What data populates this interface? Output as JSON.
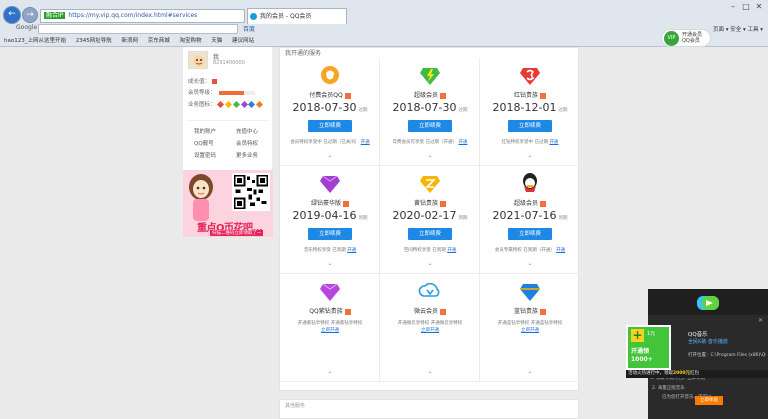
{
  "browser": {
    "address_tag": "融合IP",
    "address": "https://my.vip.qq.com/index.html#services",
    "tab_title": "我的会员 - QQ会员",
    "search_label": "Google",
    "search_placeholder": "",
    "search_engine": "百度",
    "bookmarks": [
      "hao123_上网从这里开始",
      "2345网址导航",
      "新浪网",
      "京东商城",
      "淘宝购物",
      "天猫",
      "建议网站"
    ],
    "addon_line1": "开通会员",
    "addon_line2": "QQ会员",
    "right_links": "页面 ▾  安全 ▾  工具 ▾"
  },
  "profile": {
    "username": "我",
    "userid": "8291400000",
    "row_growth": "成长值：",
    "row_level": "会员等级：",
    "row_icons": "业务图标："
  },
  "side_links": [
    "我的账户",
    "充值中心",
    "QQ靓号",
    "会员特权",
    "设置密码",
    "更多业务"
  ],
  "promo": {
    "title": "重点Q币花吧...",
    "subtitle": "扫描二维码立即领取了~"
  },
  "services": {
    "title": "我开通的服务",
    "cards": [
      {
        "name": "付费会员QQ",
        "date": "2018-07-30",
        "unit": "过期",
        "button": "立即续费",
        "note": "会员特权享受中  已过期（已关闭）",
        "note_link": "开通"
      },
      {
        "name": "超级会员",
        "date": "2018-07-30",
        "unit": "过期",
        "button": "立即续费",
        "note": "年费会员可享受  已过期（开通）",
        "note_link": "开通"
      },
      {
        "name": "红钻贵族",
        "date": "2018-12-01",
        "unit": "过期",
        "button": "立即续费",
        "note": "红钻特权享受中  已过期",
        "note_link": "开通"
      },
      {
        "name": "绿钻豪华版",
        "date": "2019-04-16",
        "unit": "到期",
        "button": "立即续费",
        "note": "音乐特权享受  已到期",
        "note_link": "开通"
      },
      {
        "name": "黄钻贵族",
        "date": "2020-02-17",
        "unit": "到期",
        "button": "立即续费",
        "note": "空间特权享受  已到期",
        "note_link": "开通"
      },
      {
        "name": "超级会员",
        "date": "2021-07-16",
        "unit": "到期",
        "button": "立即续费",
        "note": "会员专属特权  已到期（开通）",
        "note_link": "开通"
      },
      {
        "name": "QQ紫钻贵族",
        "date": "",
        "unit": "",
        "button": "",
        "note": "开通紫钻享特权  开通紫钻享特权",
        "note_link": "立即开通"
      },
      {
        "name": "微云会员",
        "date": "",
        "unit": "",
        "button": "",
        "note": "开通微云享特权  开通微云享特权",
        "note_link": "立即开通"
      },
      {
        "name": "蓝钻贵族",
        "date": "",
        "unit": "",
        "button": "",
        "note": "开通蓝钻享特权  开通蓝钻享特权",
        "note_link": "立即开通"
      }
    ]
  },
  "bottom_strip": "其他服务",
  "popup": {
    "title": "QQ音乐",
    "link": "全民K歌·音乐播放",
    "path": "打开位置：C:\\Program Files (x86)\\QQMusic",
    "badge_t1": "1元",
    "badge_t2": "开通领",
    "badge_t3": "1000+",
    "footer_pre": "活动火热进行中，领取",
    "footer_bold": "2000元",
    "footer_post": "红包",
    "line1": "1. 领取专属礼包，立即体验",
    "line2": "2. 海量正版音乐",
    "line3": "已为您打开音乐，还可以",
    "button": "立即体验"
  },
  "colors": {
    "accent_blue": "#1e88e5",
    "tag_orange": "#f36f3b",
    "promo_pink": "#e7245a",
    "popup_green": "#43c43a"
  }
}
